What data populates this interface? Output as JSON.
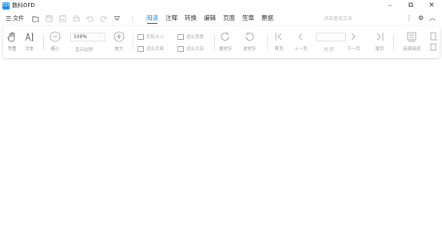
{
  "window": {
    "logo_text": "OD",
    "title": "数科OFD",
    "minimize": "–",
    "maximize": "⧉",
    "close": "✕"
  },
  "menu": {
    "file_icon": "☰",
    "file_label": "文件",
    "tabs": [
      "阅读",
      "注释",
      "转换",
      "编辑",
      "页面",
      "签章",
      "票据"
    ],
    "active_tab": "阅读",
    "search_placeholder": "点击查找文本",
    "more_icon": "⋮",
    "settings_icon": "⚙",
    "collapse_icon": "︿"
  },
  "toolbar": {
    "hand_label": "手型",
    "text_label": "文本",
    "zoom_out_label": "缩小",
    "zoom_value": "100%",
    "zoom_caret": "⌄",
    "zoom_display_label": "显示比例",
    "zoom_in_label": "放大",
    "actual_size": "实际大小",
    "fit_page": "适合页面",
    "fit_width": "适合宽度",
    "fit_height": "适合页高",
    "rotate_cw": "顺时针",
    "rotate_ccw": "逆时针",
    "first_page": "首页",
    "prev_page": "上一页",
    "page_total": "共:页",
    "next_page": "下一页",
    "last_page": "尾页",
    "continuous": "连续阅读"
  },
  "colors": {
    "accent": "#1e88e5",
    "icon_active": "#555555",
    "icon_disabled": "#bbbbbb"
  }
}
